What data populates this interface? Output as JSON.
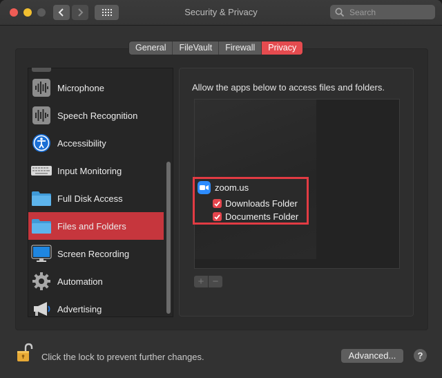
{
  "window": {
    "title": "Security & Privacy"
  },
  "search": {
    "placeholder": "Search"
  },
  "tabs": [
    {
      "label": "General",
      "active": false
    },
    {
      "label": "FileVault",
      "active": false
    },
    {
      "label": "Firewall",
      "active": false
    },
    {
      "label": "Privacy",
      "active": true
    }
  ],
  "sidebar": {
    "items": [
      {
        "label": "Microphone",
        "icon": "microphone-waveform-icon"
      },
      {
        "label": "Speech Recognition",
        "icon": "speech-waveform-icon"
      },
      {
        "label": "Accessibility",
        "icon": "accessibility-icon"
      },
      {
        "label": "Input Monitoring",
        "icon": "keyboard-icon"
      },
      {
        "label": "Full Disk Access",
        "icon": "folder-icon"
      },
      {
        "label": "Files and Folders",
        "icon": "folder-icon",
        "selected": true
      },
      {
        "label": "Screen Recording",
        "icon": "display-icon"
      },
      {
        "label": "Automation",
        "icon": "gear-icon"
      },
      {
        "label": "Advertising",
        "icon": "megaphone-icon"
      }
    ]
  },
  "main": {
    "caption": "Allow the apps below to access files and folders.",
    "app": {
      "name": "zoom.us",
      "permissions": [
        {
          "label": "Downloads Folder",
          "checked": true
        },
        {
          "label": "Documents Folder",
          "checked": true
        }
      ]
    },
    "add_label": "+",
    "remove_label": "−"
  },
  "footer": {
    "lock_text": "Click the lock to prevent further changes.",
    "advanced_label": "Advanced...",
    "help_label": "?"
  },
  "colors": {
    "accent": "#e54b4f",
    "selected_row": "#c6363d",
    "highlight_border": "#e23b43",
    "zoom_blue": "#2d8cff"
  }
}
